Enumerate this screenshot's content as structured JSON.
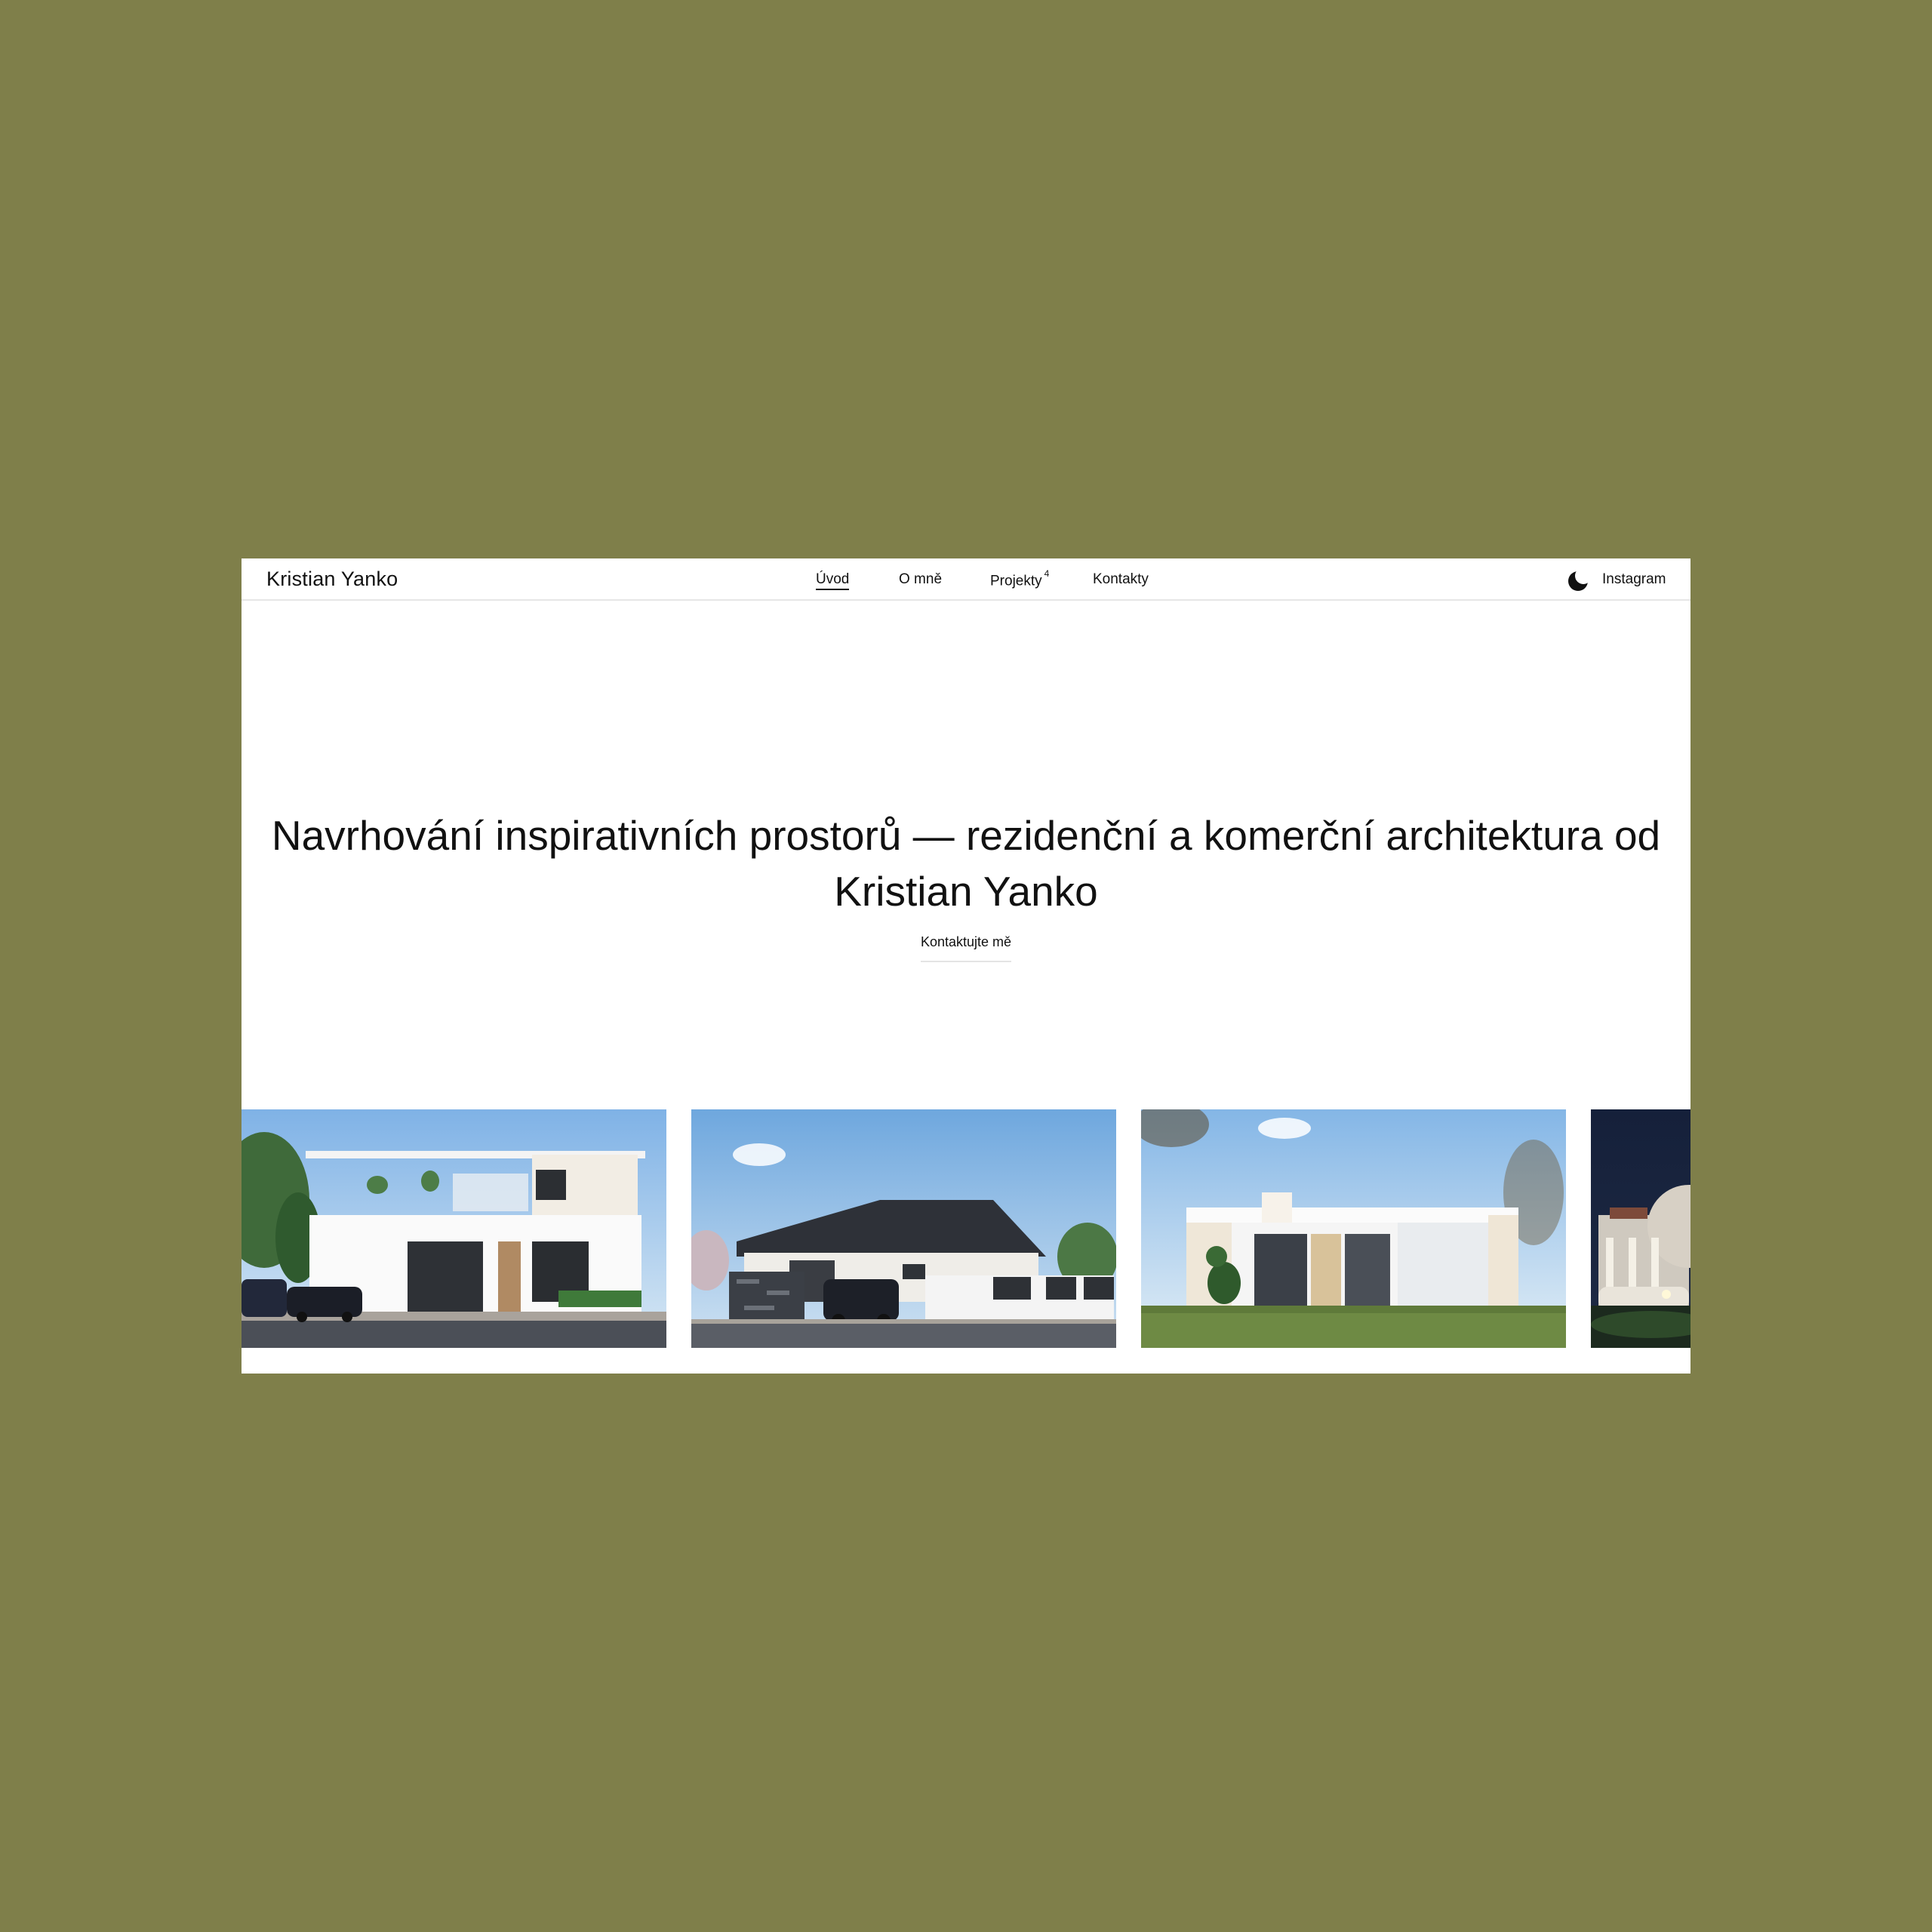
{
  "header": {
    "brand": "Kristian Yanko",
    "nav": [
      {
        "label": "Úvod",
        "active": true
      },
      {
        "label": "O mně",
        "active": false
      },
      {
        "label": "Projekty",
        "count": "4",
        "active": false
      },
      {
        "label": "Kontakty",
        "active": false
      }
    ],
    "theme_toggle_icon": "moon-icon",
    "instagram_label": "Instagram"
  },
  "hero": {
    "title_line1": "Navrhování inspirativních prostorů — rezidenční a komerční architektura od",
    "title_line2": "Kristian Yanko",
    "cta_label": "Kontaktujte mě"
  },
  "gallery": {
    "cards": [
      {
        "name": "project-modern-villa"
      },
      {
        "name": "project-bungalow-hip-roof"
      },
      {
        "name": "project-flat-roof-house"
      },
      {
        "name": "project-night-villa"
      }
    ]
  },
  "colors": {
    "page_background": "#7f7f4a",
    "window_background": "#ffffff",
    "text": "#111111"
  }
}
